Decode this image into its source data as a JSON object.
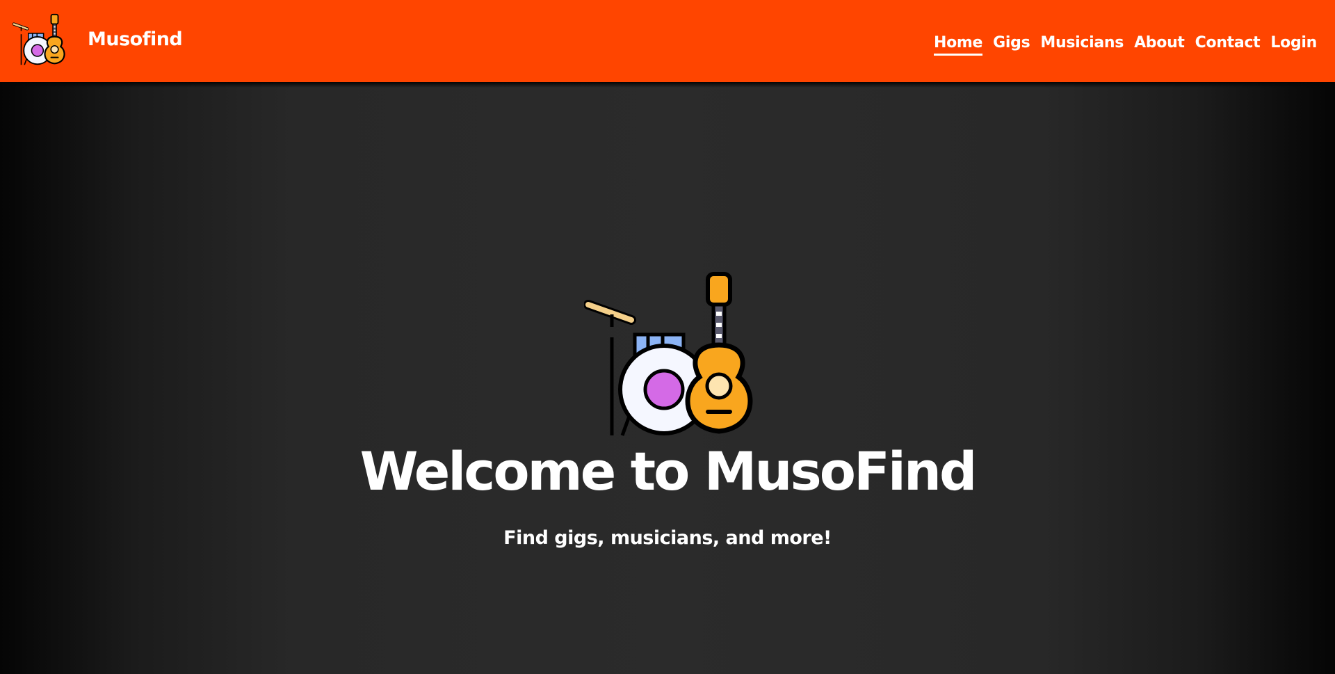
{
  "navbar": {
    "brand_name": "Musofind",
    "logo_icon": "drums-and-guitar-icon",
    "background_color": "#ff4500",
    "links": [
      {
        "label": "Home",
        "active": true
      },
      {
        "label": "Gigs",
        "active": false
      },
      {
        "label": "Musicians",
        "active": false
      },
      {
        "label": "About",
        "active": false
      },
      {
        "label": "Contact",
        "active": false
      },
      {
        "label": "Login",
        "active": false
      }
    ]
  },
  "hero": {
    "icon": "drums-and-guitar-icon",
    "title": "Welcome to MusoFind",
    "subtitle": "Find gigs, musicians, and more!",
    "background_color": "#2b2b2b"
  }
}
